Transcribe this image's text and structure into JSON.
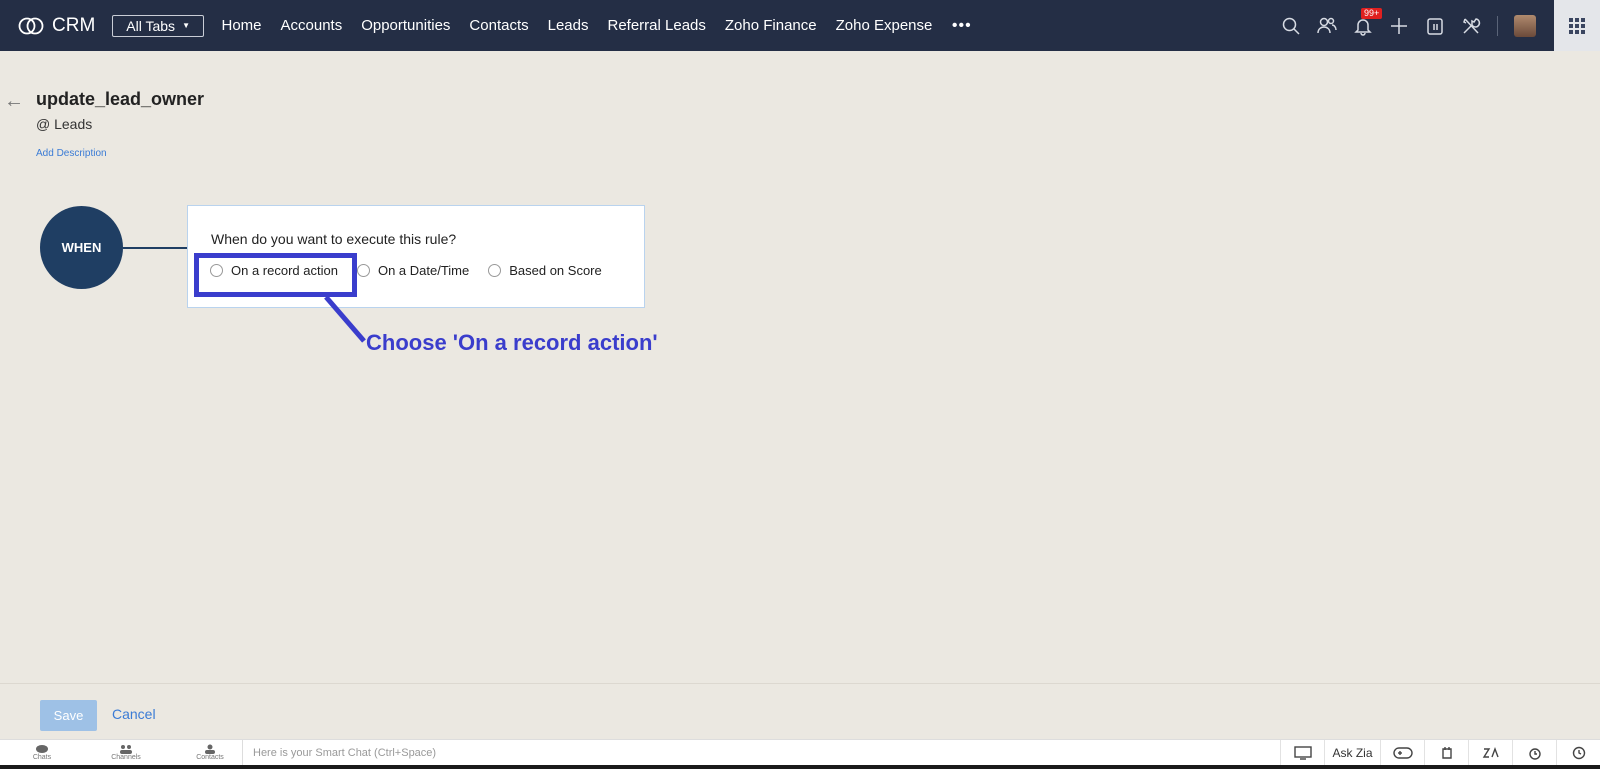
{
  "nav": {
    "brand": "CRM",
    "all_tabs": "All Tabs",
    "tabs": [
      "Home",
      "Accounts",
      "Opportunities",
      "Contacts",
      "Leads",
      "Referral Leads",
      "Zoho Finance",
      "Zoho Expense"
    ],
    "more": "•••",
    "notification_badge": "99+",
    "icons": [
      "search-icon",
      "contacts-icon",
      "bell-icon",
      "plus-icon",
      "calendar-icon",
      "setup-icon"
    ]
  },
  "rule": {
    "title": "update_lead_owner",
    "module": "@ Leads",
    "add_description": "Add Description"
  },
  "when": {
    "label": "WHEN",
    "question": "When do you want to execute this rule?",
    "options": [
      "On a record action",
      "On a Date/Time",
      "Based on Score"
    ]
  },
  "annotation": {
    "text": "Choose 'On a record action'",
    "color": "#3a3dcc"
  },
  "footer": {
    "save": "Save",
    "cancel": "Cancel"
  },
  "chatbar": {
    "tools": [
      "Chats",
      "Channels",
      "Contacts"
    ],
    "placeholder": "Here is your Smart Chat (Ctrl+Space)",
    "ask_zia": "Ask Zia"
  },
  "colors": {
    "nav_bg": "#242e45",
    "when_circle": "#1f3e63",
    "link": "#3a7bd5",
    "page_bg": "#ebe8e1"
  }
}
